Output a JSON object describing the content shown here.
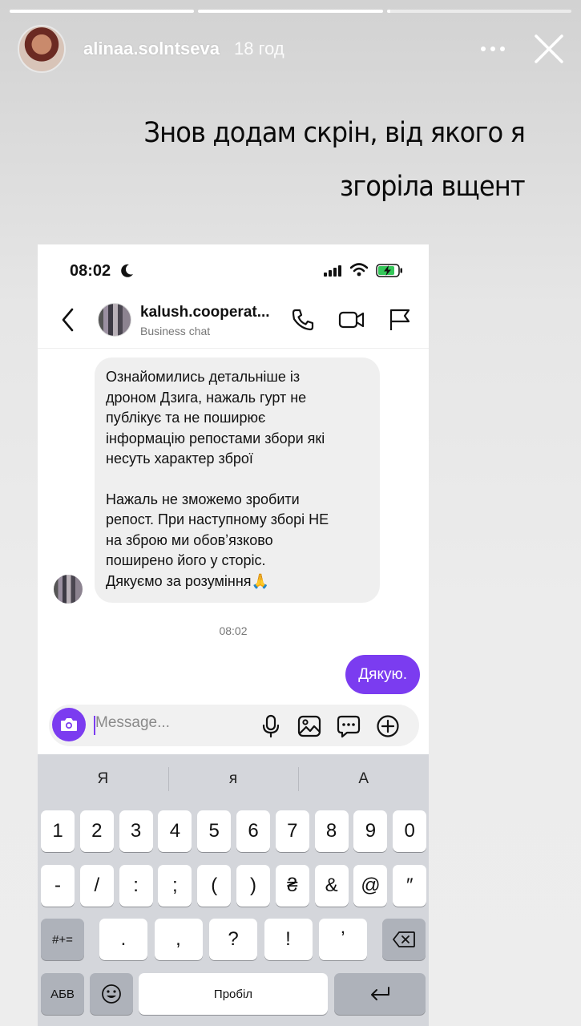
{
  "story": {
    "username": "alinaa.solntseva",
    "time": "18 год",
    "progress": [
      1,
      1,
      0.02
    ],
    "caption_line1": "Знов додам скрін, від якого я",
    "caption_line2": "згоріла вщент"
  },
  "phone": {
    "status_time": "08:02",
    "chat_name": "kalush.cooperat...",
    "chat_sub": "Business chat",
    "incoming_p1": "Ознайомились детальніше із\nдроном Дзига, нажаль гурт не\nпублікує та не поширює\nінформацію репостами збори які\nнесуть характер зброї",
    "incoming_p2": "Нажаль не зможемо зробити\nрепост. При наступному зборі НЕ\nна зброю ми обовʼязково\nпоширено його у сторіс.\nДякуємо за розуміння🙏",
    "message_time": "08:02",
    "outgoing": "Дякую.",
    "composer_placeholder": "Message..."
  },
  "keyboard": {
    "suggestions": [
      "Я",
      "я",
      "А"
    ],
    "row1": [
      "1",
      "2",
      "3",
      "4",
      "5",
      "6",
      "7",
      "8",
      "9",
      "0"
    ],
    "row2": [
      "-",
      "/",
      ":",
      ";",
      "(",
      ")",
      "₴",
      "&",
      "@",
      "″"
    ],
    "row3": [
      ".",
      ",",
      "?",
      "!",
      "ʼ"
    ],
    "symbols_key": "#+=",
    "abc_key": "АБВ",
    "space_key": "Пробіл"
  },
  "colors": {
    "accent": "#7b3cf0",
    "keyboard_bg": "#d4d6db",
    "bubble_in": "#efefef"
  }
}
